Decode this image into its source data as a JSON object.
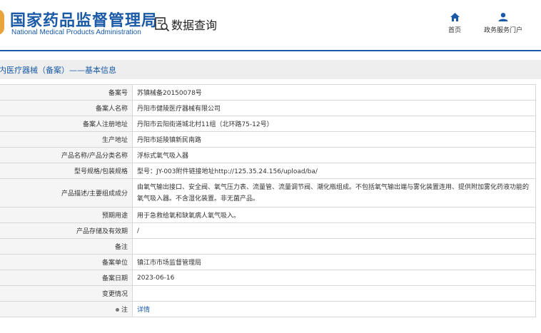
{
  "header": {
    "site_title": "国家药品监督管理局",
    "site_subtitle": "National Medical Products Administration",
    "query_label": "数据查询",
    "nav": [
      {
        "label": "首页",
        "icon": "home-icon"
      },
      {
        "label": "政务服务门户",
        "icon": "user-icon"
      }
    ]
  },
  "section": {
    "title": "内医疗器械（备案）——基本信息"
  },
  "table": {
    "rows": [
      {
        "label": "备案号",
        "value": "苏镇械备20150078号"
      },
      {
        "label": "备案人名称",
        "value": "丹阳市健陵医疗器械有限公司"
      },
      {
        "label": "备案人注册地址",
        "value": "丹阳市云阳街道城北村11组（北环路75-12号）"
      },
      {
        "label": "生产地址",
        "value": "丹阳市延陵镇新民南路"
      },
      {
        "label": "产品名称/产品分类名称",
        "value": "浮标式氧气吸入器"
      },
      {
        "label": "型号规格/包装规格",
        "value": "型号：JY-003附件链接地址http://125.35.24.156/upload/ba/"
      },
      {
        "label": "产品描述/主要组成成分",
        "value": "由氧气输出接口、安全阀、氧气压力表、流量管、流量调节阀、潮化瓶组成。不包括氧气输出端与雾化装置连用、提供附加雾化药液功能的氧气吸入器。不含湿化装置。非无菌产品。"
      },
      {
        "label": "预期用途",
        "value": "用于急救给氧和缺氧病人氧气吸入。"
      },
      {
        "label": "产品存储及有效期",
        "value": "/"
      },
      {
        "label": "备注",
        "value": ""
      },
      {
        "label": "备案单位",
        "value": "镇江市市场监督管理局"
      },
      {
        "label": "备案日期",
        "value": "2023-06-16"
      },
      {
        "label": "变更情况",
        "value": ""
      },
      {
        "label": "注",
        "value": "详情"
      }
    ]
  },
  "colors": {
    "brand_blue": "#1a5aa6",
    "emblem_gold": "#e8a43b",
    "label_bg": "#f5f5f5",
    "section_bg": "#eeeeee",
    "border": "#d7d7d7"
  }
}
